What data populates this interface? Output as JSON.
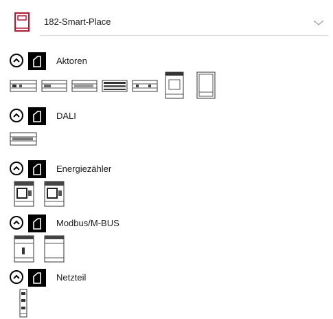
{
  "header": {
    "project": "182-Smart-Place"
  },
  "categories": [
    {
      "label": "Aktoren"
    },
    {
      "label": "DALI"
    },
    {
      "label": "Energiezähler"
    },
    {
      "label": "Modbus/M-BUS"
    },
    {
      "label": "Netzteil"
    }
  ],
  "colors": {
    "accent": "#c8102e",
    "category_icon_bg": "#000000",
    "divider": "#d9d9d9"
  }
}
